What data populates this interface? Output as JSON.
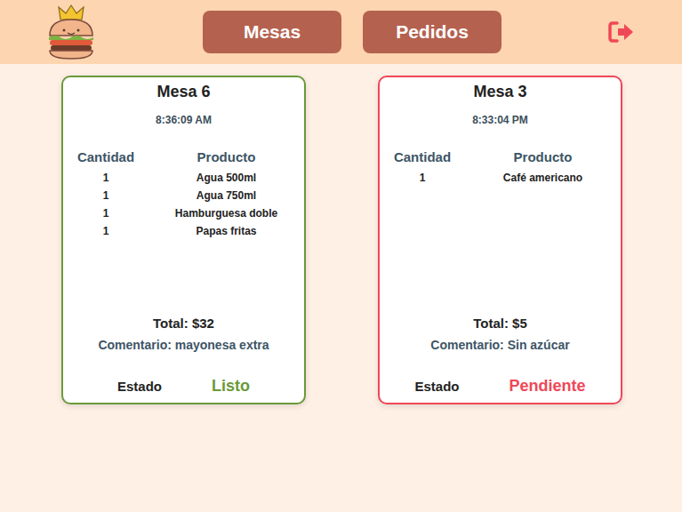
{
  "nav": {
    "buttons": [
      {
        "label": "Mesas"
      },
      {
        "label": "Pedidos"
      }
    ]
  },
  "orders": [
    {
      "table": "Mesa 6",
      "time": "8:36:09 AM",
      "columns": [
        "Cantidad",
        "Producto"
      ],
      "items": [
        {
          "qty": "1",
          "product": "Agua 500ml"
        },
        {
          "qty": "1",
          "product": "Agua 750ml"
        },
        {
          "qty": "1",
          "product": "Hamburguesa doble"
        },
        {
          "qty": "1",
          "product": "Papas fritas"
        }
      ],
      "total": "Total: $32",
      "comment": "Comentario: mayonesa extra",
      "status_label": "Estado",
      "status": "Listo",
      "color": "#6a9a3a"
    },
    {
      "table": "Mesa 3",
      "time": "8:33:04 PM",
      "columns": [
        "Cantidad",
        "Producto"
      ],
      "items": [
        {
          "qty": "1",
          "product": "Café americano"
        }
      ],
      "total": "Total: $5",
      "comment": "Comentario: Sin azúcar",
      "status_label": "Estado",
      "status": "Pendiente",
      "color": "#f04757"
    }
  ]
}
